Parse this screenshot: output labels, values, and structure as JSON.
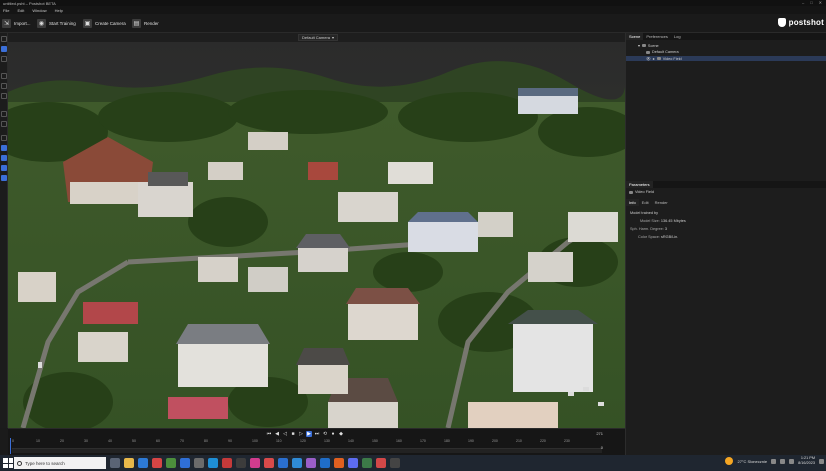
{
  "window": {
    "title": "untitled.psht – Postshot BETA",
    "controls": [
      "–",
      "□",
      "✕"
    ]
  },
  "menu": [
    "File",
    "Edit",
    "Window",
    "Help"
  ],
  "toolbar": {
    "import_label": "Import...",
    "start_training_label": "Start Training",
    "create_camera_label": "Create Camera",
    "render_label": "Render"
  },
  "brand": {
    "name": "postshot",
    "accent": "#3b6fd8"
  },
  "viewport": {
    "camera_select": "Default Camera",
    "camera_chevron": "▾"
  },
  "timeline": {
    "ticks": [
      "0",
      "10",
      "20",
      "30",
      "40",
      "50",
      "60",
      "70",
      "80",
      "90",
      "100",
      "110",
      "120",
      "130",
      "140",
      "150",
      "160",
      "170",
      "180",
      "190",
      "200",
      "210",
      "220",
      "230"
    ],
    "frame_end": "271",
    "frame_current": "0"
  },
  "panels": {
    "top_tabs": [
      "Scene",
      "Preferences",
      "Log"
    ],
    "scene_tree": {
      "root": "Scene",
      "camera": "Default Camera",
      "radiance_field": "Video Field"
    },
    "parameters_title": "Parameters",
    "selected_object": "Video Field",
    "param_tabs": [
      "Info",
      "Edit",
      "Render"
    ],
    "info": {
      "model_trained_by": "Model trained by",
      "model_size_label": "Model Size:",
      "model_size_value": "136.45 Mbytes",
      "sph_label": "Sph. Harm. Degree:",
      "sph_value": "3",
      "color_space_label": "Color Space:",
      "color_space_value": "sRGB/Lin."
    }
  },
  "taskbar": {
    "search_placeholder": "Type here to search",
    "weather": "27°C  Slonecznie",
    "time": "1:21 PM",
    "date": "8/16/2023"
  }
}
